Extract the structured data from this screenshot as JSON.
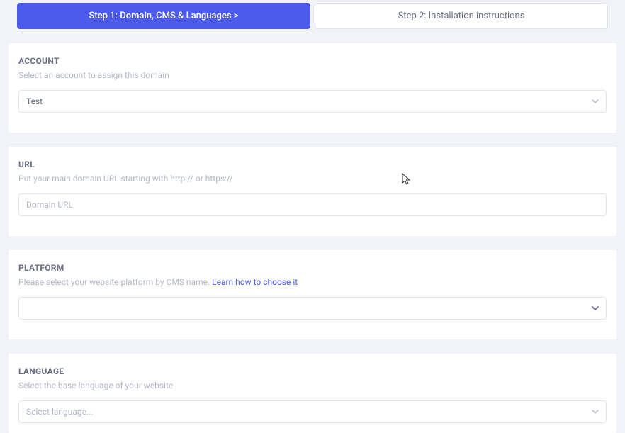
{
  "tabs": {
    "step1": "Step 1: Domain, CMS & Languages  >",
    "step2": "Step 2: Installation instructions"
  },
  "account": {
    "title": "ACCOUNT",
    "subtitle": "Select an account to assign this domain",
    "value": "Test"
  },
  "url": {
    "title": "URL",
    "subtitle": "Put your main domain URL starting with http:// or https://",
    "placeholder": "Domain URL",
    "value": ""
  },
  "platform": {
    "title": "PLATFORM",
    "subtitle_prefix": "Please select your website platform by CMS name.  ",
    "link_text": "Learn how to choose it",
    "value": ""
  },
  "language": {
    "title": "LANGUAGE",
    "subtitle": "Select the base language of your website",
    "placeholder": "Select language..."
  }
}
